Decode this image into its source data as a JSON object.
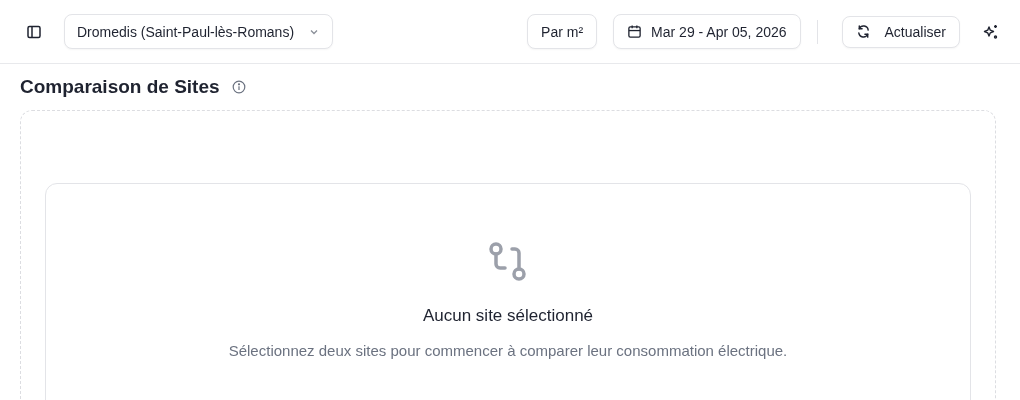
{
  "header": {
    "site_select": {
      "value": "Dromedis (Saint-Paul-lès-Romans)"
    },
    "unit_button": "Par m²",
    "date_range": "Mar 29 - Apr 05, 2026",
    "refresh_button": "Actualiser"
  },
  "page": {
    "title": "Comparaison de Sites"
  },
  "empty_state": {
    "title": "Aucun site sélectionné",
    "message": "Sélectionnez deux sites pour commencer à comparer leur consommation électrique."
  }
}
